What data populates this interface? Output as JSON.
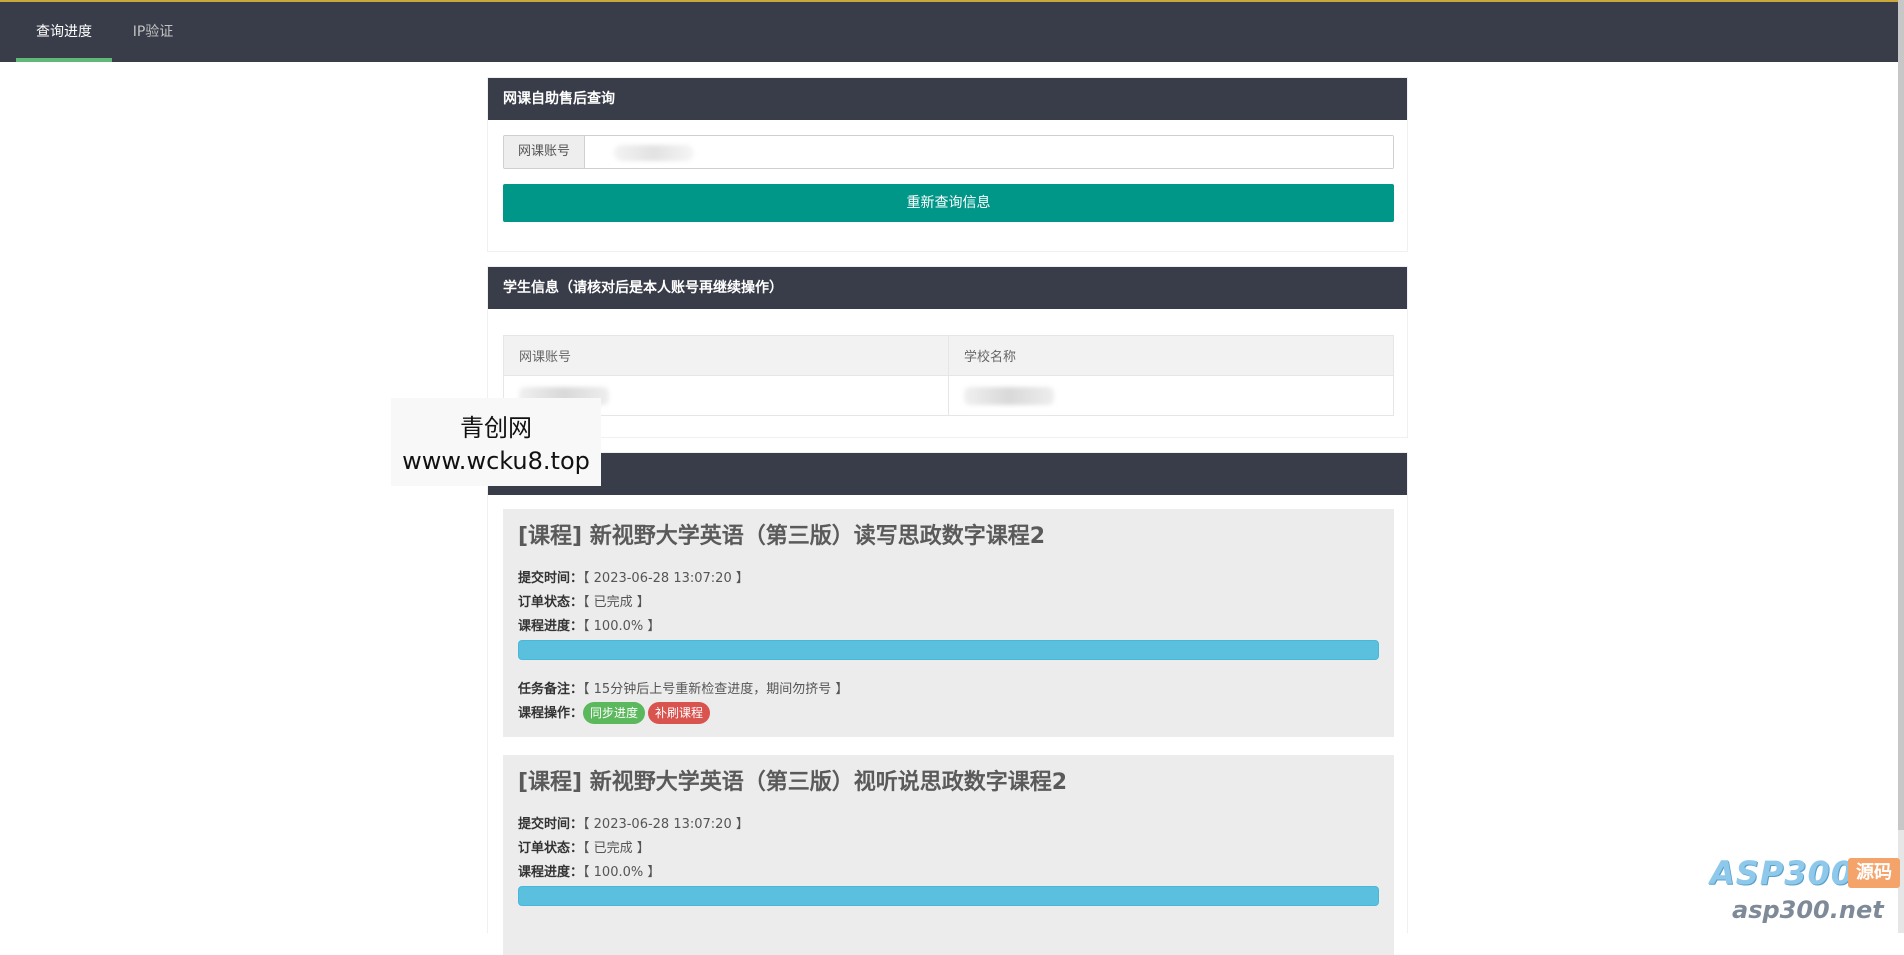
{
  "nav": {
    "tabs": [
      {
        "label": "查询进度",
        "active": true
      },
      {
        "label": "IP验证",
        "active": false
      }
    ],
    "accent_color": "#5fb878"
  },
  "query_card": {
    "header": "网课自助售后查询",
    "account_label": "网课账号",
    "account_value": "",
    "submit_label": "重新查询信息"
  },
  "student_card": {
    "header": "学生信息（请核对后是本人账号再继续操作）",
    "columns": [
      "网课账号",
      "学校名称"
    ]
  },
  "watermark": {
    "line1": "青创网",
    "line2": "www.wcku8.top"
  },
  "courses": [
    {
      "title": "[课程] 新视野大学英语（第三版）读写思政数字课程2",
      "submit_label": "提交时间：",
      "submit_value": "【 2023-06-28 13:07:20 】",
      "status_label": "订单状态：",
      "status_value": "【 已完成 】",
      "progress_label": "课程进度：",
      "progress_value": "【 100.0% 】",
      "progress": 1.0,
      "note_label": "任务备注：",
      "note_value": "【 15分钟后上号重新检查进度，期间勿挤号 】",
      "ops_label": "课程操作：",
      "ops": [
        {
          "label": "同步进度",
          "color": "#5cb85c"
        },
        {
          "label": "补刷课程",
          "color": "#d9534f"
        }
      ]
    },
    {
      "title": "[课程] 新视野大学英语（第三版）视听说思政数字课程2",
      "submit_label": "提交时间：",
      "submit_value": "【 2023-06-28 13:07:20 】",
      "status_label": "订单状态：",
      "status_value": "【 已完成 】",
      "progress_label": "课程进度：",
      "progress_value": "【 100.0% 】",
      "progress": 1.0
    }
  ],
  "brand_watermark": {
    "main": "ASP300",
    "tag": "源码",
    "url": "asp300.net"
  }
}
